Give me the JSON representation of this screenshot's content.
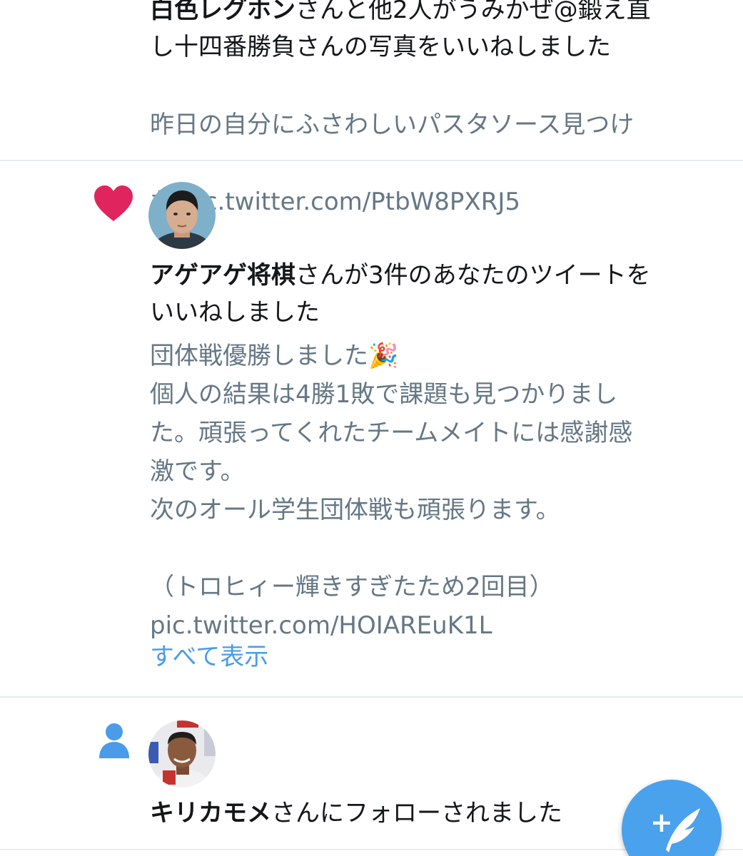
{
  "notifications": [
    {
      "type": "like",
      "headline_name": "白色レグホン",
      "headline_rest_line1": "さんと他2人がうみかぜ@鍛え直",
      "headline_line2": "し十四番勝負さんの写真をいいねしました",
      "body_line1": "昨日の自分にふさわしいパスタソース見つけ",
      "body_line2": "た pic.twitter.com/PtbW8PXRJ5"
    },
    {
      "type": "like",
      "icon": "heart-icon",
      "headline_name": "アゲアゲ将棋",
      "headline_rest_line1": "さんが3件のあなたのツイートを",
      "headline_line2": "いいねしました",
      "body_text": "団体戦優勝しました🎉\n個人の結果は4勝1敗で課題も見つかりまし\nた。頑張ってくれたチームメイトには感謝感\n激です。\n次のオール学生団体戦も頑張ります。\n\n（トロヒィー輝きすぎたため2回目）\npic.twitter.com/HOIAREuK1L",
      "show_all_label": "すべて表示"
    },
    {
      "type": "follow",
      "icon": "person-icon",
      "headline_name": "キリカモメ",
      "headline_rest": "さんにフォローされました"
    }
  ],
  "compose_button": {
    "icon": "compose-tweet-icon",
    "symbol": "+"
  },
  "colors": {
    "like_red": "#e0245e",
    "follow_blue": "#4a9be8",
    "fab_blue": "#4aa1ec",
    "link_blue": "#4a9be8",
    "secondary_text": "#657786",
    "primary_text": "#14171a"
  }
}
